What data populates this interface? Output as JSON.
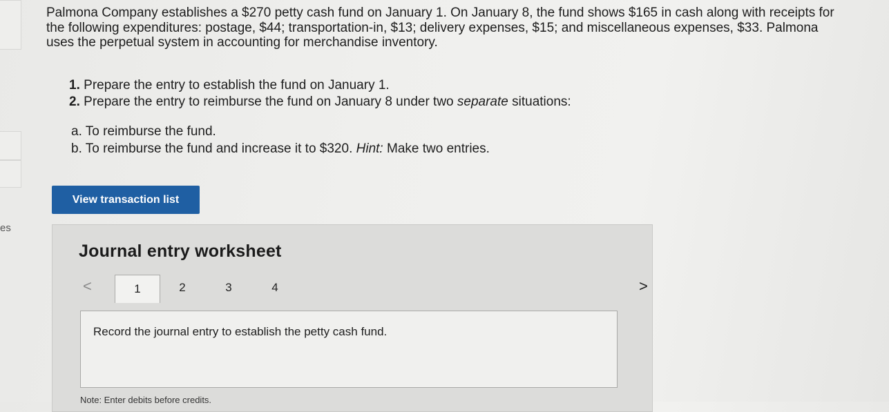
{
  "sidebar": {
    "partial_label": "es"
  },
  "problem": {
    "intro_lines": [
      "Palmona Company establishes a $270 petty cash fund on January 1. On January 8, the fund shows $165 in cash along with receipts for",
      "the following expenditures: postage, $44; transportation-in, $13; delivery expenses, $15; and miscellaneous expenses, $33. Palmona",
      "uses the perpetual system in accounting for merchandise inventory."
    ],
    "step1_num": "1.",
    "step1_text": "Prepare the entry to establish the fund on January 1.",
    "step2_num": "2.",
    "step2_before": "Prepare the entry to reimburse the fund on January 8 under two ",
    "step2_em": "separate",
    "step2_after": " situations:",
    "sub_a": "a. To reimburse the fund.",
    "sub_b_text": "b. To reimburse the fund and increase it to $320. ",
    "sub_b_hint": "Hint:",
    "sub_b_after": " Make two entries."
  },
  "buttons": {
    "view_transactions": "View transaction list"
  },
  "worksheet": {
    "title": "Journal entry worksheet",
    "prev_symbol": "<",
    "next_symbol": ">",
    "tabs": [
      "1",
      "2",
      "3",
      "4"
    ],
    "active_tab": "1",
    "instruction": "Record the journal entry to establish the petty cash fund.",
    "note": "Note: Enter debits before credits."
  },
  "colors": {
    "accent": "#1f5fa3"
  }
}
